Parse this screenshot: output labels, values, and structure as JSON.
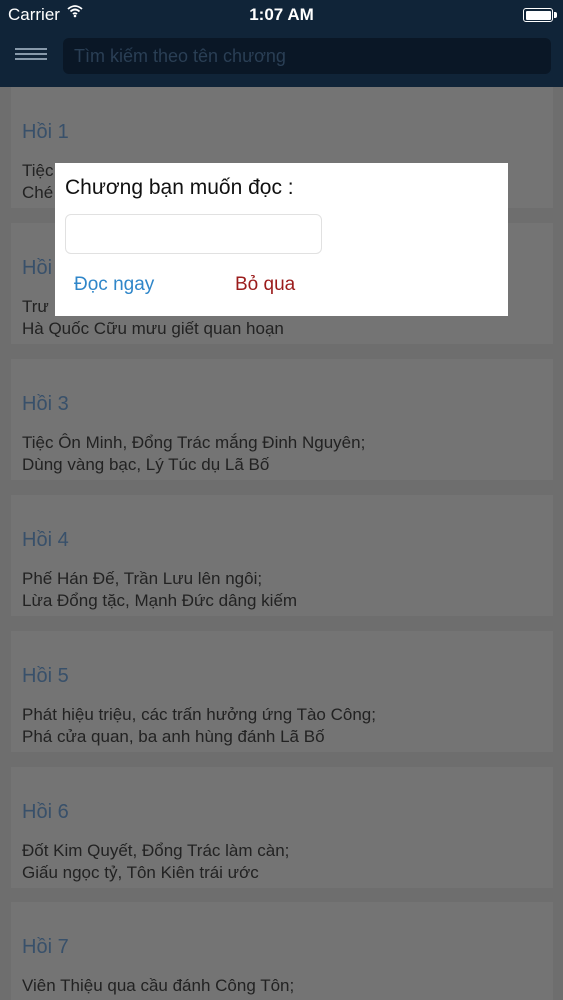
{
  "status_bar": {
    "carrier": "Carrier",
    "time": "1:07 AM"
  },
  "search": {
    "placeholder": "Tìm kiếm theo tên chương"
  },
  "chapters": [
    {
      "title": "Hồi 1",
      "line1": "Tiệc",
      "line2": "Ché"
    },
    {
      "title": "Hồi",
      "line1": "Trư",
      "line2": "Hà Quốc Cữu mưu giết quan hoạn"
    },
    {
      "title": "Hồi 3",
      "line1": "Tiệc Ôn Minh, Đổng Trác mắng Đinh Nguyên;",
      "line2": "Dùng vàng bạc, Lý Túc dụ Lã Bố"
    },
    {
      "title": "Hồi 4",
      "line1": "Phế Hán Đế, Trần Lưu lên ngôi;",
      "line2": "Lừa Đổng tặc, Mạnh Đức dâng kiếm"
    },
    {
      "title": "Hồi 5",
      "line1": "Phát hiệu triệu, các trấn hưởng ứng Tào Công;",
      "line2": "Phá cửa quan, ba anh hùng đánh Lã Bố"
    },
    {
      "title": "Hồi 6",
      "line1": "Đốt Kim Quyết, Đổng Trác làm càn;",
      "line2": "Giấu ngọc tỷ, Tôn Kiên trái ước"
    },
    {
      "title": "Hồi 7",
      "line1": "Viên Thiệu qua cầu đánh Công Tôn;",
      "line2": ""
    }
  ],
  "dialog": {
    "title": "Chương bạn muốn đọc :",
    "input_value": "",
    "read_label": "Đọc ngay",
    "skip_label": "Bỏ qua"
  }
}
